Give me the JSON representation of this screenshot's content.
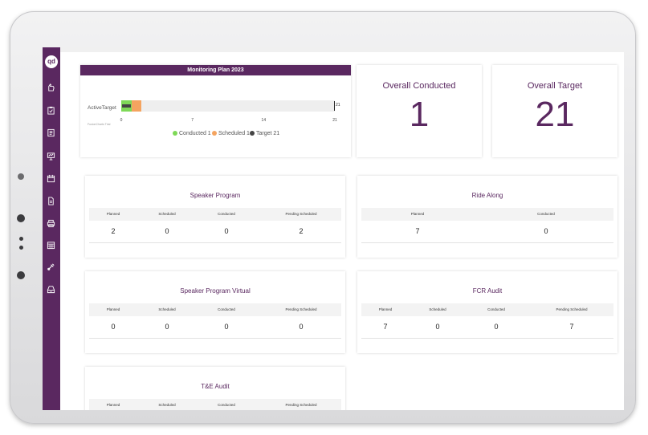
{
  "sidebar": {
    "logo": "qd",
    "icons": [
      "hand-icon",
      "clipboard-icon",
      "checklist-icon",
      "presentation-icon",
      "calendar-icon",
      "document-icon",
      "printer-icon",
      "calendar-grid-icon",
      "tools-icon",
      "inbox-icon"
    ]
  },
  "monitoring": {
    "title": "Monitoring Plan 2023",
    "category": "ActiveTarget",
    "credit": "FusionCharts Trial",
    "target_marker": "21",
    "ticks": [
      "0",
      "7",
      "14",
      "21"
    ],
    "legend": [
      {
        "label": "Conducted 1",
        "color": "#7ed957"
      },
      {
        "label": "Scheduled 1",
        "color": "#f4a460"
      },
      {
        "label": "Target 21",
        "color": "#444444"
      }
    ]
  },
  "chart_data": {
    "type": "bar",
    "title": "Monitoring Plan 2023",
    "categories": [
      "ActiveTarget"
    ],
    "series": [
      {
        "name": "Conducted",
        "values": [
          1
        ]
      },
      {
        "name": "Scheduled",
        "values": [
          1
        ]
      },
      {
        "name": "Target",
        "values": [
          21
        ]
      }
    ],
    "xlim": [
      0,
      21
    ]
  },
  "overall_conducted": {
    "label": "Overall Conducted",
    "value": "1"
  },
  "overall_target": {
    "label": "Overall Target",
    "value": "21"
  },
  "sections": {
    "speaker_program": {
      "title": "Speaker Program",
      "headers": [
        "Planned",
        "Scheduled",
        "Conducted",
        "Pending Scheduled"
      ],
      "values": [
        "2",
        "0",
        "0",
        "2"
      ]
    },
    "ride_along": {
      "title": "Ride Along",
      "headers": [
        "Planned",
        "Conducted"
      ],
      "values": [
        "7",
        "0"
      ]
    },
    "speaker_program_virtual": {
      "title": "Speaker Program Virtual",
      "headers": [
        "Planned",
        "Scheduled",
        "Conducted",
        "Pending Scheduled"
      ],
      "values": [
        "0",
        "0",
        "0",
        "0"
      ]
    },
    "fcr_audit": {
      "title": "FCR Audit",
      "headers": [
        "Planned",
        "Scheduled",
        "Conducted",
        "Pending Scheduled"
      ],
      "values": [
        "7",
        "0",
        "0",
        "7"
      ]
    },
    "te_audit": {
      "title": "T&E Audit",
      "headers": [
        "Planned",
        "Scheduled",
        "Conducted",
        "Pending Scheduled"
      ]
    }
  }
}
